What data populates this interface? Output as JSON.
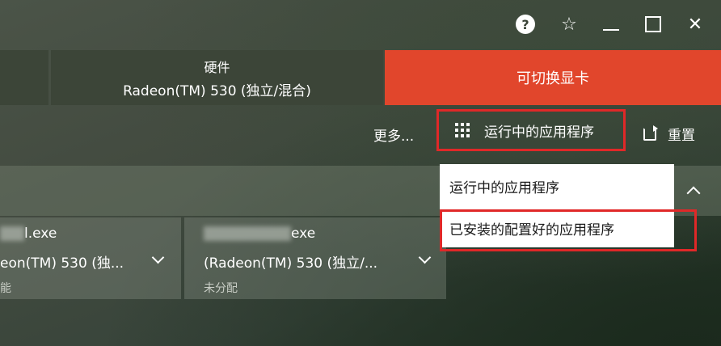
{
  "titlebar": {
    "help_icon": "?",
    "favorite_icon": "star-icon",
    "minimize_icon": "minimize-icon",
    "maximize_icon": "maximize-icon",
    "close_icon": "close-icon"
  },
  "tabs": {
    "hardware_title": "硬件",
    "hardware_value": "Radeon(TM) 530 (独立/混合)",
    "switchable_label": "可切换显卡"
  },
  "toolbar": {
    "more_label": "更多...",
    "running_apps_label": "运行中的应用程序",
    "reset_label": "重置"
  },
  "dropdown": {
    "items": [
      {
        "label": "运行中的应用程序"
      },
      {
        "label": "已安装的配置好的应用程序"
      }
    ]
  },
  "apps": [
    {
      "name_suffix": "l.exe",
      "gpu": "eon(TM) 530 (独...",
      "status": "能"
    },
    {
      "name_suffix": "exe",
      "gpu": "(Radeon(TM) 530 (独立/...",
      "status": "未分配"
    }
  ],
  "colors": {
    "accent": "#e1462c",
    "highlight_border": "#e02828"
  }
}
